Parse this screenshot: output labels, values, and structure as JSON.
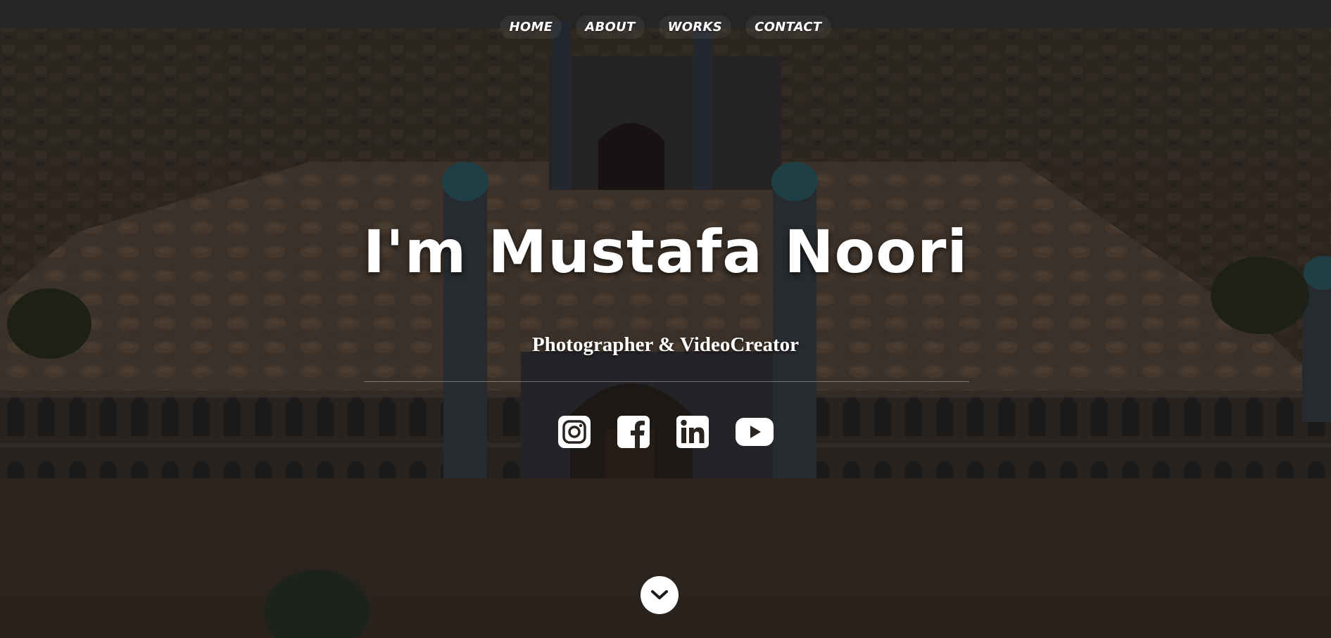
{
  "nav": {
    "items": [
      {
        "label": "HOME"
      },
      {
        "label": "ABOUT"
      },
      {
        "label": "WORKS"
      },
      {
        "label": "CONTACT"
      }
    ]
  },
  "hero": {
    "headline": "I'm Mustafa Noori",
    "subtitle": "Photographer & VideoCreator"
  },
  "social": {
    "icons": [
      "instagram-icon",
      "facebook-icon",
      "linkedin-icon",
      "youtube-icon"
    ]
  },
  "scroll": {
    "icon": "chevron-down-icon"
  },
  "colors": {
    "text": "#ffffff",
    "overlay": "#0a0806"
  }
}
